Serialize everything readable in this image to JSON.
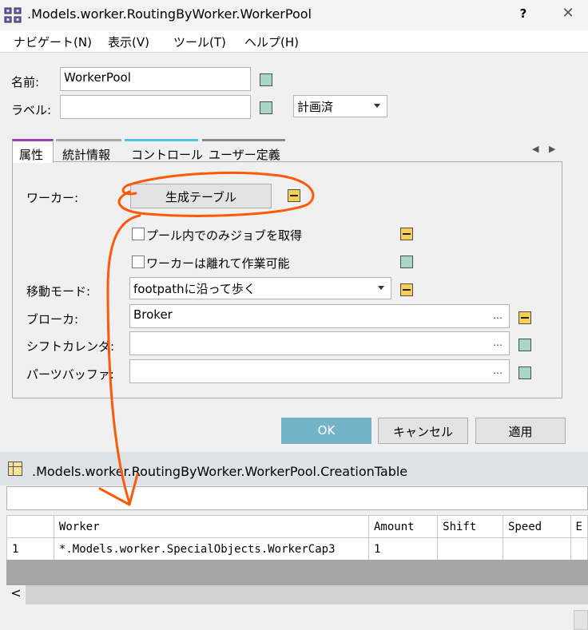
{
  "dialog": {
    "title": ".Models.worker.RoutingByWorker.WorkerPool",
    "help": "?",
    "close": "✕"
  },
  "menu": {
    "items": [
      "ナビゲート(N)",
      "表示(V)",
      "ツール(T)",
      "ヘルプ(H)"
    ]
  },
  "form": {
    "name_label": "名前:",
    "name_value": "WorkerPool",
    "label_label": "ラベル:",
    "label_value": "",
    "plan_value": "計画済"
  },
  "tabs": [
    "属性",
    "統計情報",
    "コントロール",
    "ユーザー定義"
  ],
  "props": {
    "worker_label": "ワーカー:",
    "creation_table_button": "生成テーブル",
    "checkbox1": "プール内でのみジョブを取得",
    "checkbox2": "ワーカーは離れて作業可能",
    "move_mode_label": "移動モード:",
    "move_mode_value": "footpathに沿って歩く",
    "broker_label": "ブローカ:",
    "broker_value": "Broker",
    "shift_label": "シフトカレンダ:",
    "shift_value": "",
    "buffer_label": "パーツバッファ:",
    "buffer_value": "",
    "ellipsis": "…"
  },
  "buttons": {
    "ok": "OK",
    "cancel": "キャンセル",
    "apply": "適用"
  },
  "colors": {
    "ok_button": "#73b4c8",
    "annotation": "#ff5a0a",
    "green_square": "#a7d7c5",
    "yellow_square": "#f7cf56"
  },
  "creation_table": {
    "title": ".Models.worker.RoutingByWorker.WorkerPool.CreationTable",
    "columns": [
      "Worker",
      "Amount",
      "Shift",
      "Speed",
      "E"
    ],
    "rows": [
      {
        "index": "1",
        "cells": [
          "*.Models.worker.SpecialObjects.WorkerCap3",
          "1",
          "",
          "",
          ""
        ]
      }
    ],
    "scroll_left": "<"
  }
}
